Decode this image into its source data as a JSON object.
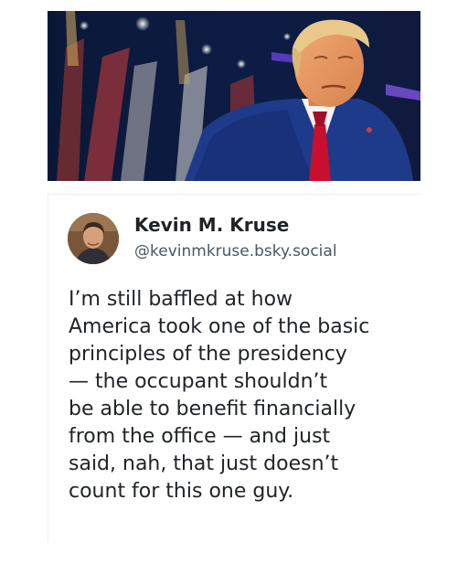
{
  "post": {
    "author_name": "Kevin M. Kruse",
    "author_handle": "@kevinmkruse.bsky.social",
    "text_lines": [
      "I’m still baffled at how",
      "America took one of the basic",
      "principles of the presidency",
      "— the occupant shouldn’t",
      "be able to benefit financially",
      "from the office — and just",
      "said, nah, that just doesn’t",
      "count for this one guy."
    ]
  },
  "colors": {
    "text": "#1f2328",
    "handle": "#4b5563",
    "photo_background": "#0b1430",
    "suit": "#1e3a8a",
    "tie": "#c8102e"
  },
  "icons": {
    "avatar": "author-avatar-photo"
  }
}
